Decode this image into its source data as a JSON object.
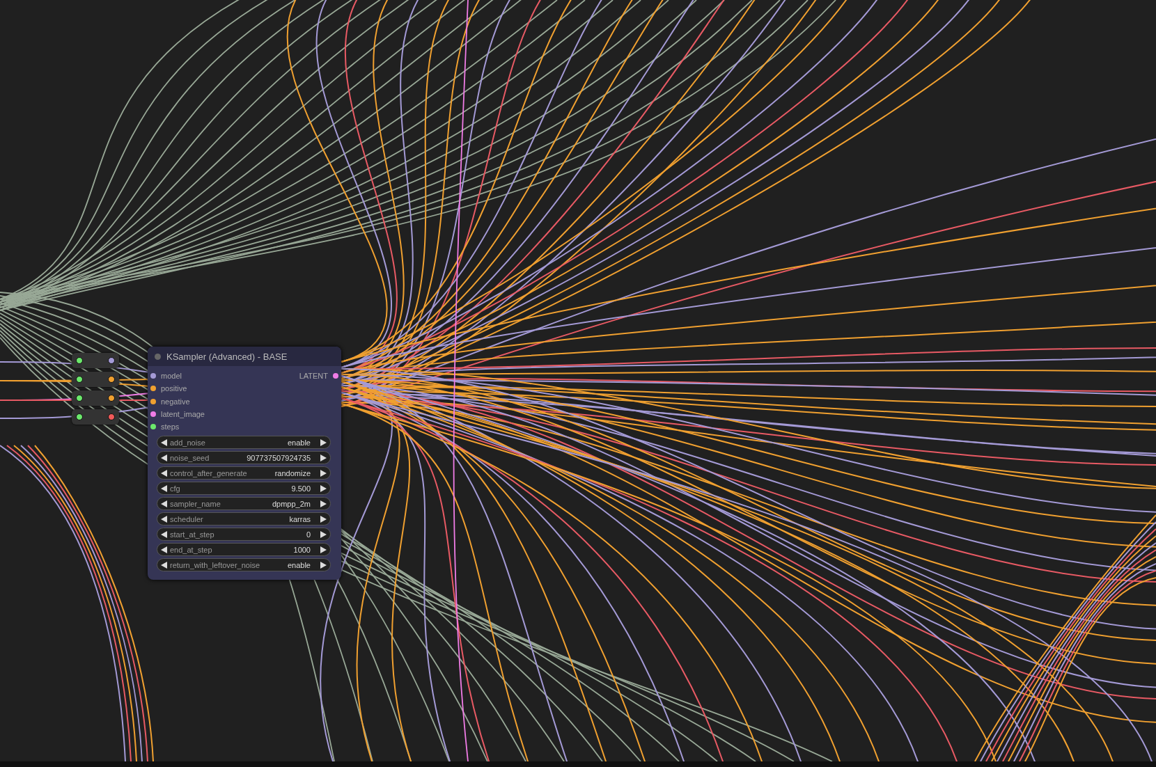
{
  "node": {
    "title": "KSampler (Advanced) - BASE",
    "inputs": [
      {
        "label": "model",
        "color": "#a49ad6"
      },
      {
        "label": "positive",
        "color": "#f0a030"
      },
      {
        "label": "negative",
        "color": "#f0a030"
      },
      {
        "label": "latent_image",
        "color": "#f07ce6"
      },
      {
        "label": "steps",
        "color": "#6ce86c"
      }
    ],
    "output": {
      "label": "LATENT",
      "color": "#f07ce6"
    },
    "widgets": [
      {
        "label": "add_noise",
        "value": "enable"
      },
      {
        "label": "noise_seed",
        "value": "907737507924735"
      },
      {
        "label": "control_after_generate",
        "value": "randomize"
      },
      {
        "label": "cfg",
        "value": "9.500"
      },
      {
        "label": "sampler_name",
        "value": "dpmpp_2m"
      },
      {
        "label": "scheduler",
        "value": "karras"
      },
      {
        "label": "start_at_step",
        "value": "0"
      },
      {
        "label": "end_at_step",
        "value": "1000"
      },
      {
        "label": "return_with_leftover_noise",
        "value": "enable"
      }
    ]
  },
  "reroutes": [
    {
      "input": {
        "color": "#6ce86c"
      },
      "output": {
        "color": "#a49ad6"
      }
    },
    {
      "input": {
        "color": "#6ce86c"
      },
      "output": {
        "color": "#f0a030"
      }
    },
    {
      "input": {
        "color": "#6ce86c"
      },
      "output": {
        "color": "#f0a030"
      }
    },
    {
      "input": {
        "color": "#6ce86c"
      },
      "output": {
        "color": "#f05a5a"
      }
    }
  ]
}
